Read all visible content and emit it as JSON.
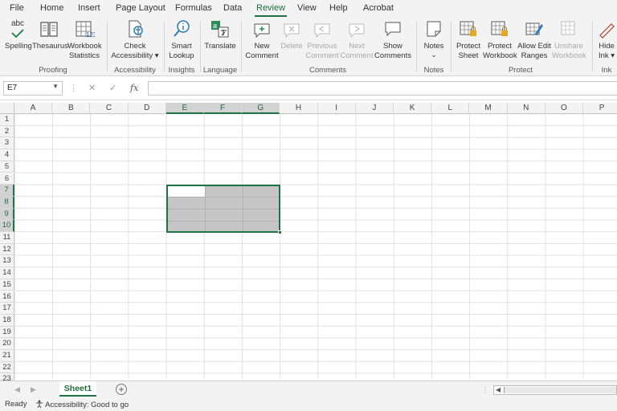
{
  "menu_tabs": [
    "File",
    "Home",
    "Insert",
    "Page Layout",
    "Formulas",
    "Data",
    "Review",
    "View",
    "Help",
    "Acrobat"
  ],
  "active_tab": "Review",
  "ribbon": {
    "spelling_abc": "abc",
    "spelling": "Spelling",
    "thesaurus": "Thesaurus",
    "workbook_statistics": [
      "Workbook",
      "Statistics"
    ],
    "check_accessibility": [
      "Check",
      "Accessibility"
    ],
    "accessibility_caret": "▾",
    "smart_lookup": [
      "Smart",
      "Lookup"
    ],
    "translate": "Translate",
    "new_comment": [
      "New",
      "Comment"
    ],
    "delete": "Delete",
    "previous_comment": [
      "Previous",
      "Comment"
    ],
    "next_comment": [
      "Next",
      "Comment"
    ],
    "show_comments": [
      "Show",
      "Comments"
    ],
    "notes": "Notes",
    "notes_caret": "⌄",
    "protect_sheet": [
      "Protect",
      "Sheet"
    ],
    "protect_workbook": [
      "Protect",
      "Workbook"
    ],
    "allow_edit_ranges": [
      "Allow Edit",
      "Ranges"
    ],
    "unshare_workbook": [
      "Unshare",
      "Workbook"
    ],
    "hide_ink": [
      "Hide",
      "Ink ▾"
    ],
    "groups": {
      "proofing": "Proofing",
      "accessibility": "Accessibility",
      "insights": "Insights",
      "language": "Language",
      "comments": "Comments",
      "notes": "Notes",
      "protect": "Protect",
      "ink": "Ink"
    }
  },
  "formula_bar": {
    "name_box": "E7",
    "cancel_icon": "✕",
    "enter_icon": "✓",
    "fx_label": "fx",
    "formula_value": ""
  },
  "columns": [
    "A",
    "B",
    "C",
    "D",
    "E",
    "F",
    "G",
    "H",
    "I",
    "J",
    "K",
    "L",
    "M",
    "N",
    "O",
    "P"
  ],
  "selected_columns": [
    "E",
    "F",
    "G"
  ],
  "rows": [
    "1",
    "2",
    "3",
    "4",
    "5",
    "6",
    "7",
    "8",
    "9",
    "10",
    "11",
    "12",
    "13",
    "14",
    "15",
    "16",
    "17",
    "18",
    "19",
    "20",
    "21",
    "22",
    "23"
  ],
  "selected_rows": [
    "7",
    "8",
    "9",
    "10"
  ],
  "selection": {
    "range": "E7:G10",
    "active_cell": "E7"
  },
  "sheets": [
    "Sheet1"
  ],
  "active_sheet": "Sheet1",
  "add_sheet_icon": "+",
  "status": {
    "ready": "Ready",
    "accessibility": "Accessibility: Good to go"
  },
  "colors": {
    "excel_green": "#217346",
    "selection_fill": "#c6c6c6",
    "header_bg": "#f3f3f3"
  }
}
